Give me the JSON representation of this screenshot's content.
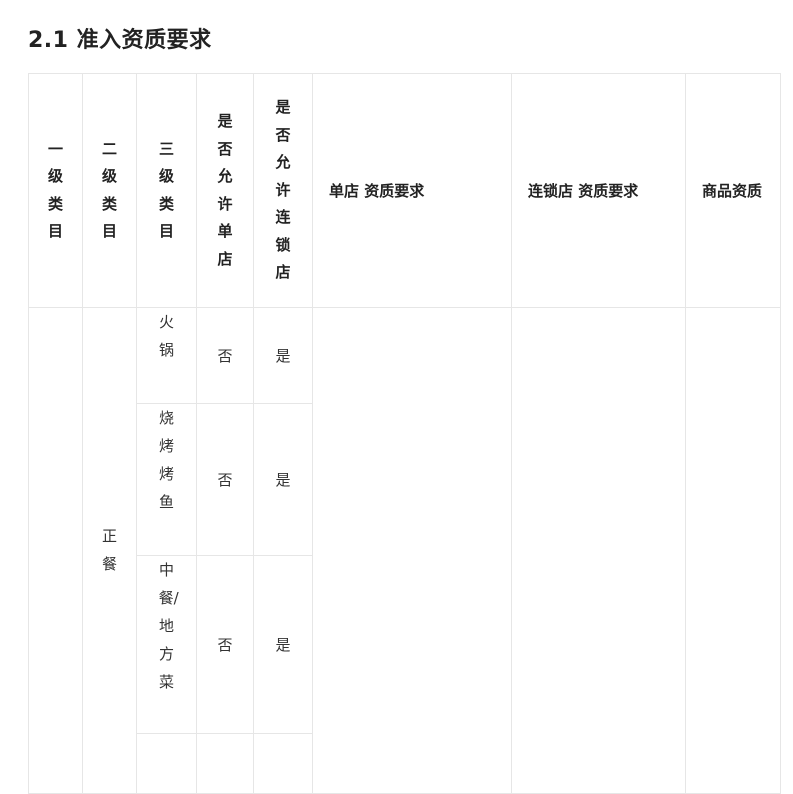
{
  "section": {
    "title": "2.1 准入资质要求"
  },
  "table": {
    "headers": {
      "level1": "一级类目",
      "level2": "二级类目",
      "level3": "三级类目",
      "allow_single": "是否允许单店",
      "allow_chain": "是否允许连锁店",
      "single_req": "单店 资质要求",
      "chain_req": "连锁店 资质要求",
      "product_qual": "商品资质"
    },
    "group": {
      "level2": "正餐"
    },
    "rows": [
      {
        "level3": "火锅",
        "allow_single": "否",
        "allow_chain": "是"
      },
      {
        "level3": "烧烤烤鱼",
        "allow_single": "否",
        "allow_chain": "是"
      },
      {
        "level3": "中餐/地方菜",
        "allow_single": "否",
        "allow_chain": "是"
      }
    ]
  }
}
